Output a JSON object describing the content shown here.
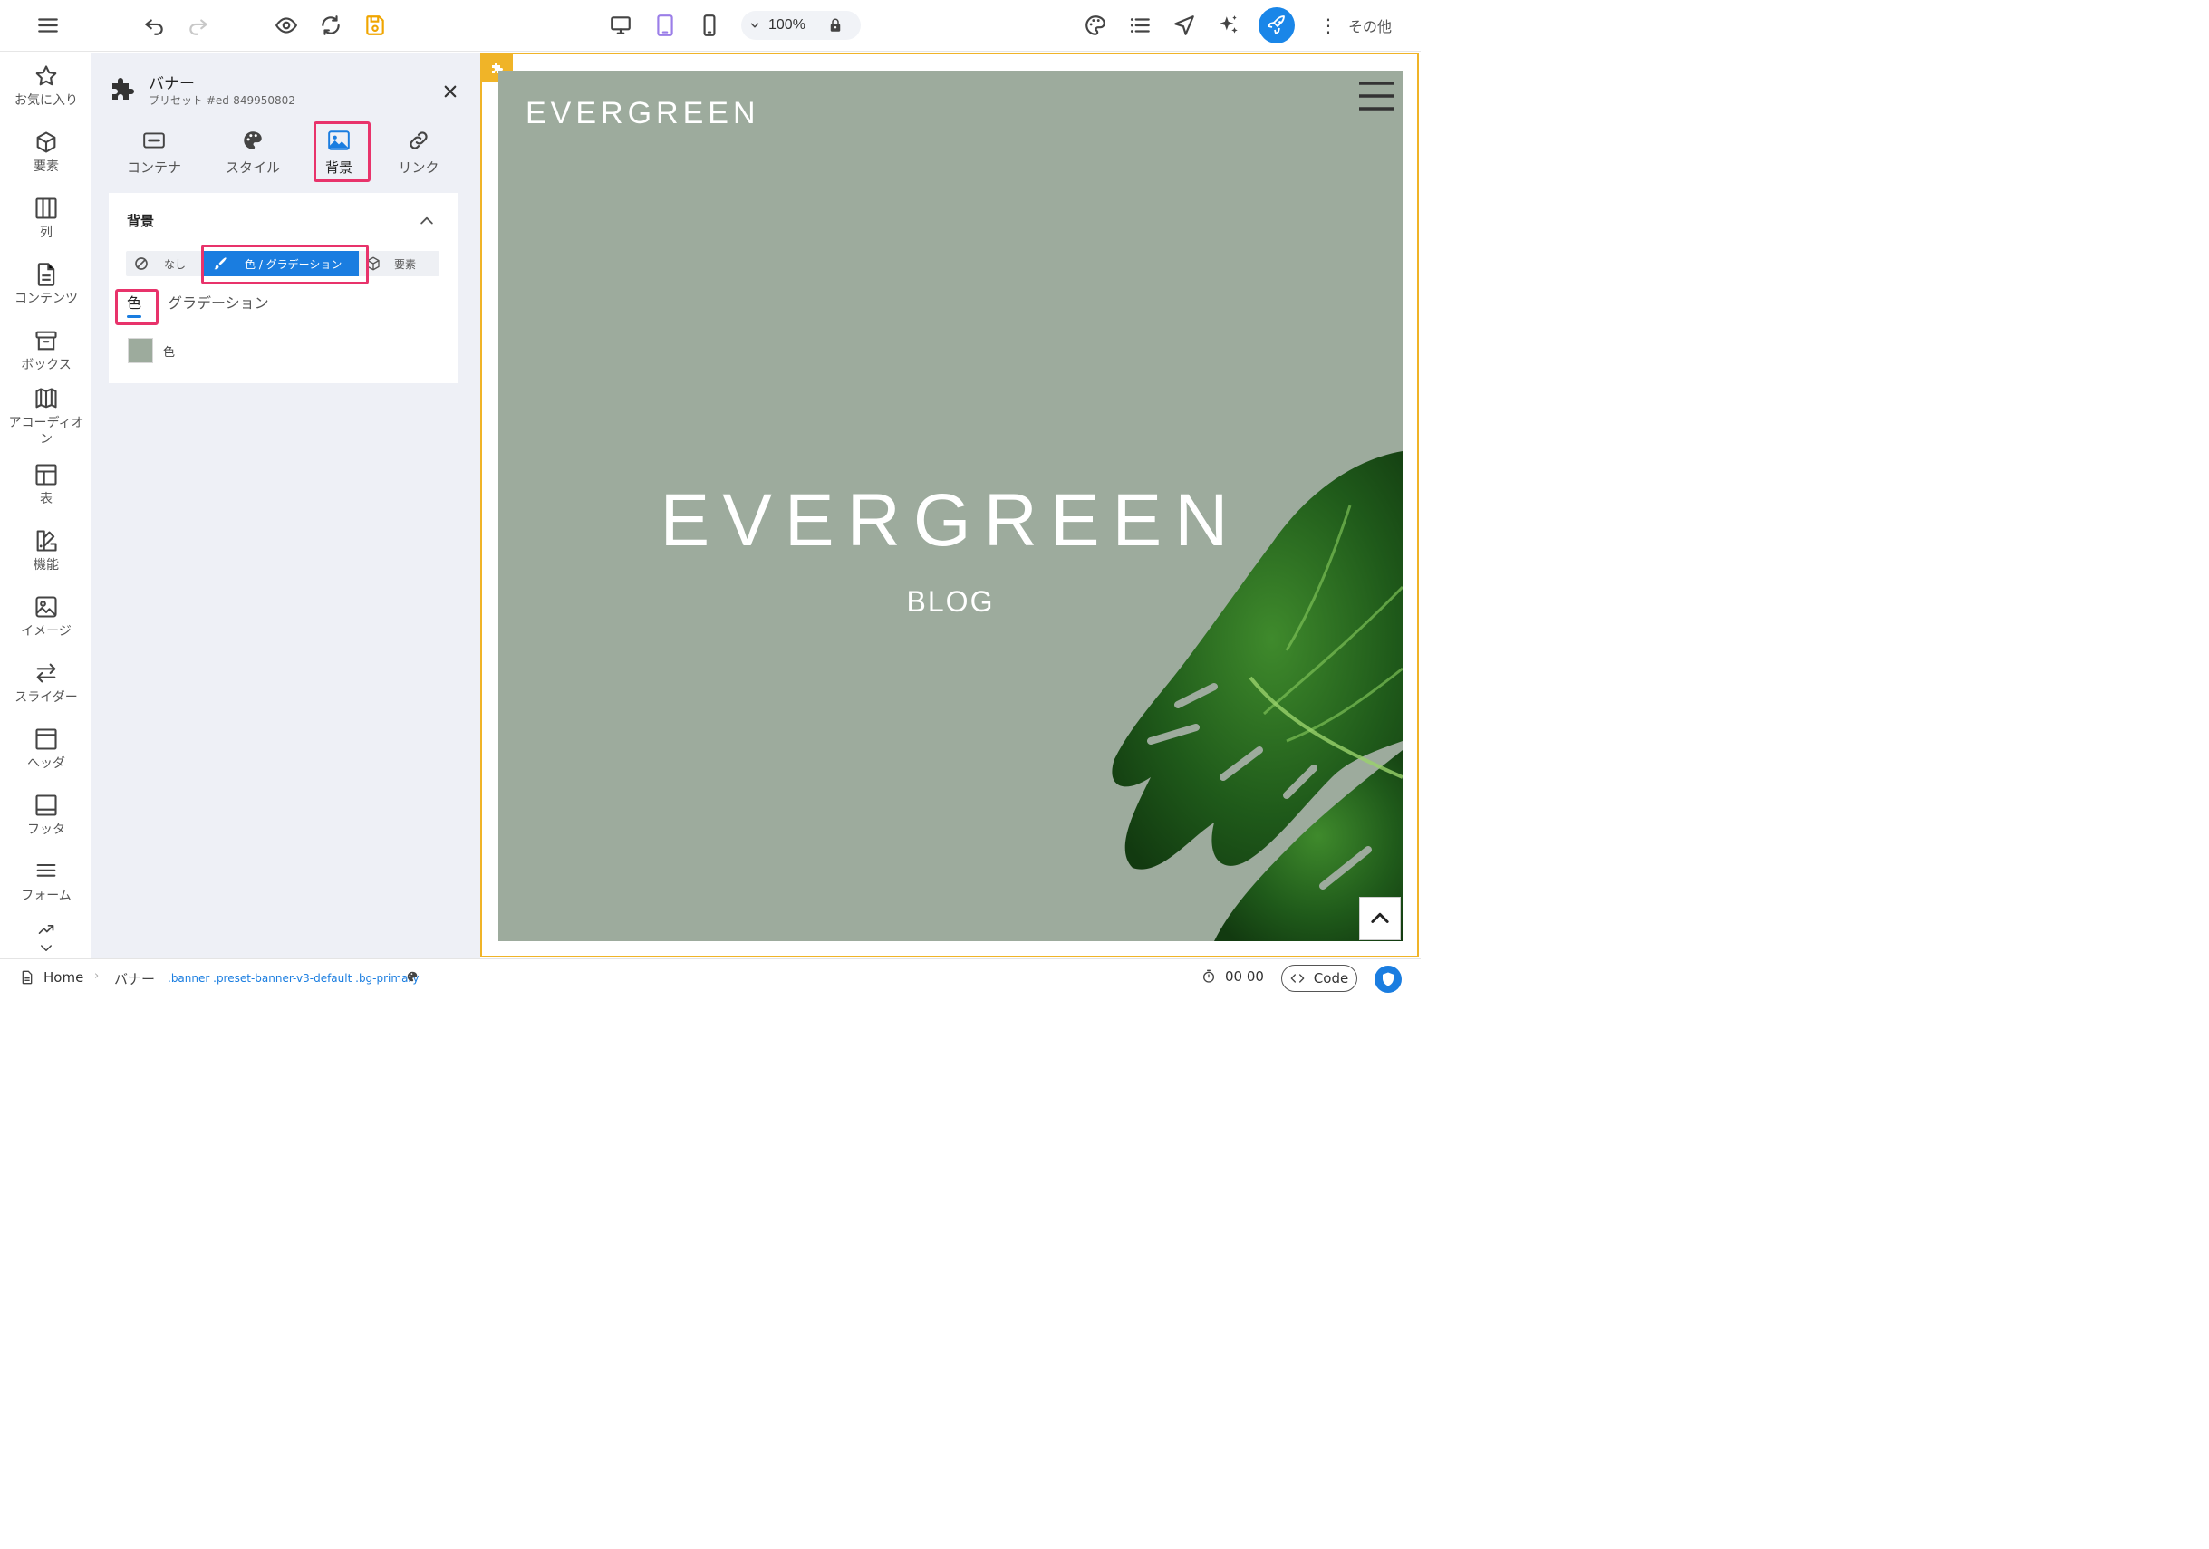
{
  "toolbar": {
    "zoom": "100%",
    "more_label": "その他"
  },
  "sidebar": {
    "items": [
      {
        "label": "お気に入り",
        "icon": "star-icon"
      },
      {
        "label": "要素",
        "icon": "cube-icon"
      },
      {
        "label": "列",
        "icon": "columns-icon"
      },
      {
        "label": "コンテンツ",
        "icon": "document-icon"
      },
      {
        "label": "ボックス",
        "icon": "box-icon"
      },
      {
        "label": "アコーディオン",
        "icon": "accordion-icon"
      },
      {
        "label": "表",
        "icon": "table-icon"
      },
      {
        "label": "機能",
        "icon": "features-icon"
      },
      {
        "label": "イメージ",
        "icon": "image-icon"
      },
      {
        "label": "スライダー",
        "icon": "slider-icon"
      },
      {
        "label": "ヘッダ",
        "icon": "header-icon"
      },
      {
        "label": "フッタ",
        "icon": "footer-icon"
      },
      {
        "label": "フォーム",
        "icon": "form-icon"
      }
    ]
  },
  "panel": {
    "title": "バナー",
    "subtitle": "プリセット #ed-849950802",
    "tabs": [
      {
        "label": "コンテナ"
      },
      {
        "label": "スタイル"
      },
      {
        "label": "背景"
      },
      {
        "label": "リンク"
      }
    ],
    "background": {
      "section_title": "背景",
      "options": {
        "none": "なし",
        "color": "色 / グラデーション",
        "element": "要素"
      },
      "subtabs": {
        "color": "色",
        "gradient": "グラデーション"
      },
      "swatch_label": "色",
      "swatch_color": "#9dab9d"
    }
  },
  "canvas": {
    "logo": "EVERGREEN",
    "hero_title": "EVERGREEN",
    "hero_subtitle": "BLOG",
    "banner_color": "#9dab9d",
    "frame_color": "#f0b428"
  },
  "statusbar": {
    "home": "Home",
    "crumb": "バナー",
    "classes": ".banner .preset-banner-v3-default .bg-primary",
    "timer": "00 00",
    "code_label": "Code"
  }
}
